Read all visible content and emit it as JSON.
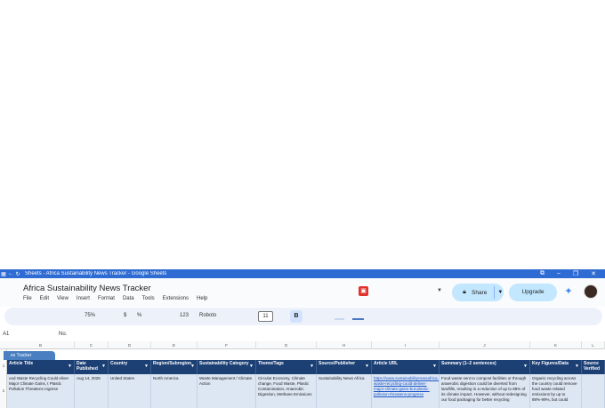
{
  "window": {
    "title": "Sheets - Africa Sustainability News Tracker - Google Sheets",
    "icons": [
      "sheets-app-icon",
      "back-arrow-icon",
      "reload-icon",
      "extensions-icon",
      "minimize-icon",
      "restore-icon",
      "close-icon"
    ]
  },
  "doc": {
    "title": "Africa Sustainability News Tracker"
  },
  "menu": [
    "File",
    "Edit",
    "View",
    "Insert",
    "Format",
    "Data",
    "Tools",
    "Extensions",
    "Help"
  ],
  "header": {
    "share_label": "Share",
    "upgrade_label": "Upgrade"
  },
  "toolbar": {
    "zoom": "75%",
    "currency": "$",
    "percent": "%",
    "number_format": "123",
    "font": "Roboto",
    "font_size": "11",
    "bold": "B"
  },
  "formula": {
    "cell_ref": "A1",
    "value": "No."
  },
  "table": {
    "name": "es Tracker",
    "column_letters": [
      "B",
      "C",
      "D",
      "E",
      "F",
      "G",
      "H",
      "I",
      "J",
      "K",
      "L"
    ],
    "row_numbers": [
      "1",
      "2"
    ],
    "headers": [
      "Article Title",
      "Date Published",
      "Country",
      "Region/Subregion",
      "Sustainability Category",
      "Theme/Tags",
      "Source/Publisher",
      "Article URL",
      "Summary (1–2 sentences)",
      "Key Figures/Data",
      "Source Verified"
    ],
    "row": [
      "ood Waste Recycling Could eliver Major Climate Gains, t Plastic Pollution Threatens rogress",
      "Aug 14, 2026",
      "United States",
      "North America",
      "Waste Management / Climate Action",
      "Circular Economy, Climate change, Food Waste, Plastic Contamination, Anaerobic Digestion, Methane Emissions",
      "Sustainability News Africa",
      "https://www.sustainabilitynewsafrica.com/stories/food-waste-recycling-could-deliver-major-climate-gains-but-plastic-pollution-threatens-progress",
      "Food waste sent to compost facilities or through anaerobic digestion could be diverted from landfills, resulting in a reduction of up to 88% of its climate impact. However, without redesigning our food packaging for better recycling",
      "Organic recycling across the country could remove food waste related emissions by up to 88%-99%, but could"
    ]
  }
}
